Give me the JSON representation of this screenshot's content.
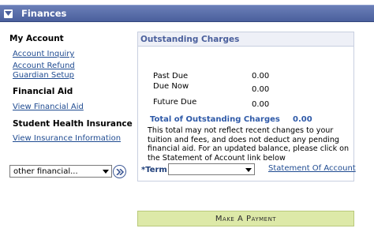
{
  "header": {
    "title": "Finances"
  },
  "left": {
    "my_account": {
      "title": "My Account",
      "links": [
        "Account Inquiry",
        "Account Refund",
        "Guardian Setup"
      ]
    },
    "financial_aid": {
      "title": "Financial Aid",
      "links": [
        "View Financial Aid"
      ]
    },
    "student_health": {
      "title": "Student Health Insurance",
      "links": [
        "View Insurance Information"
      ]
    },
    "other_select": {
      "value": "other financial..."
    }
  },
  "panel": {
    "title": "Outstanding Charges",
    "rows": [
      {
        "label": "Past Due",
        "value": "0.00"
      },
      {
        "label": "Due Now",
        "value": "0.00"
      },
      {
        "label": "Future Due",
        "value": "0.00"
      }
    ],
    "total": {
      "label": "Total of Outstanding Charges",
      "value": "0.00"
    },
    "note": "This total may not reflect recent changes to your tuition and fees, and does not deduct any pending financial aid. For an updated balance, please click on the Statement of Account link below",
    "term": {
      "label": "*Term",
      "value": ""
    },
    "statement_link": "Statement Of Account"
  },
  "pay_button": {
    "label": "Make A Payment"
  },
  "colors": {
    "header_bg": "#4a5f9c",
    "link": "#1f4b91",
    "accent_blue": "#2f5aa8",
    "pay_button_bg": "#dde9a8"
  }
}
